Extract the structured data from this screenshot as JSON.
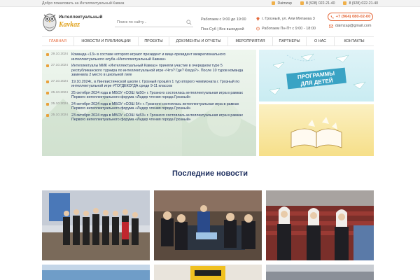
{
  "topbar": {
    "welcome": "Добро пожаловать на Интеллектуальный Кавказ",
    "contacts": [
      "Daimzap",
      "8 (928) 022-21-40",
      "8 (928) 022-21-40"
    ]
  },
  "logo": {
    "line1": "Интеллектуальный",
    "line2": "Kavkaz"
  },
  "search": {
    "placeholder": "Поиск по сайту..."
  },
  "hours": {
    "line1": "Работаем с 9:00 до 19:00",
    "line2": "Пон-Суб | Вск выходной"
  },
  "address": {
    "line1": "г. Грозный, ул. Али Митаева 3",
    "line2": "Работаем Пн-Пт с 9:00 - 18:00"
  },
  "phone": "+7 (964) 080-02-00",
  "email": "daimzap@gmail.com",
  "nav": [
    "Главная",
    "Новости и публикации",
    "Проекты",
    "Документы и отчеты",
    "Мероприятия",
    "Партнеры",
    "О нас",
    "Контакты"
  ],
  "news": [
    {
      "date": "29.10.2024",
      "text": "Команда «13» в составе которого играют президент и вице-президент межрегионального интеллектуального клуба «Интеллектуальный Кавказ»"
    },
    {
      "date": "27.10.2024",
      "text": "Интеллектуалы МИК «Интеллектуальный Кавказ» приняли участие в очередном туре 5 республиканского турнира по интеллектуальной игре «Что? Где? Когда?». После 10 туров команда заменила 2 место в школьной лиге"
    },
    {
      "date": "27.10.2024",
      "text": "19.10.2024г., в Лингвистической школе г. Грозный прошёл 1 тур второго чемпионата г. Грозный по интеллектуальной игре #ТОГДЕКОГДА среди 9-11 классов"
    },
    {
      "date": "25.10.2024",
      "text": "25 октября 2024 года в МБОУ «СОШ №50» г. Грозного состоялась интеллектуальная игра в рамках Первого интеллектуального форума «Лидер чтения города Грозный»"
    },
    {
      "date": "25.10.2024",
      "text": "24 октября 2024 года в МБОУ «СОШ 54» г. Грозного состоялась интеллектуальная игра в рамках Первого интеллектуального форума «Лидер чтения города Грозный»"
    },
    {
      "date": "25.10.2024",
      "text": "23 октября 2024 года в МБОУ «СОШ №53» г. Грозного состоялась интеллектуальная игра в рамках Первого интеллектуального форума «Лидер чтения города Грозный»"
    }
  ],
  "promo": {
    "kids_line1": "Программы",
    "kids_line2": "для детей"
  },
  "section_title": "Последние новости",
  "colors": {
    "accent": "#e56a3c",
    "brand_gold": "#e0a11a",
    "navy": "#1a2b5c"
  }
}
